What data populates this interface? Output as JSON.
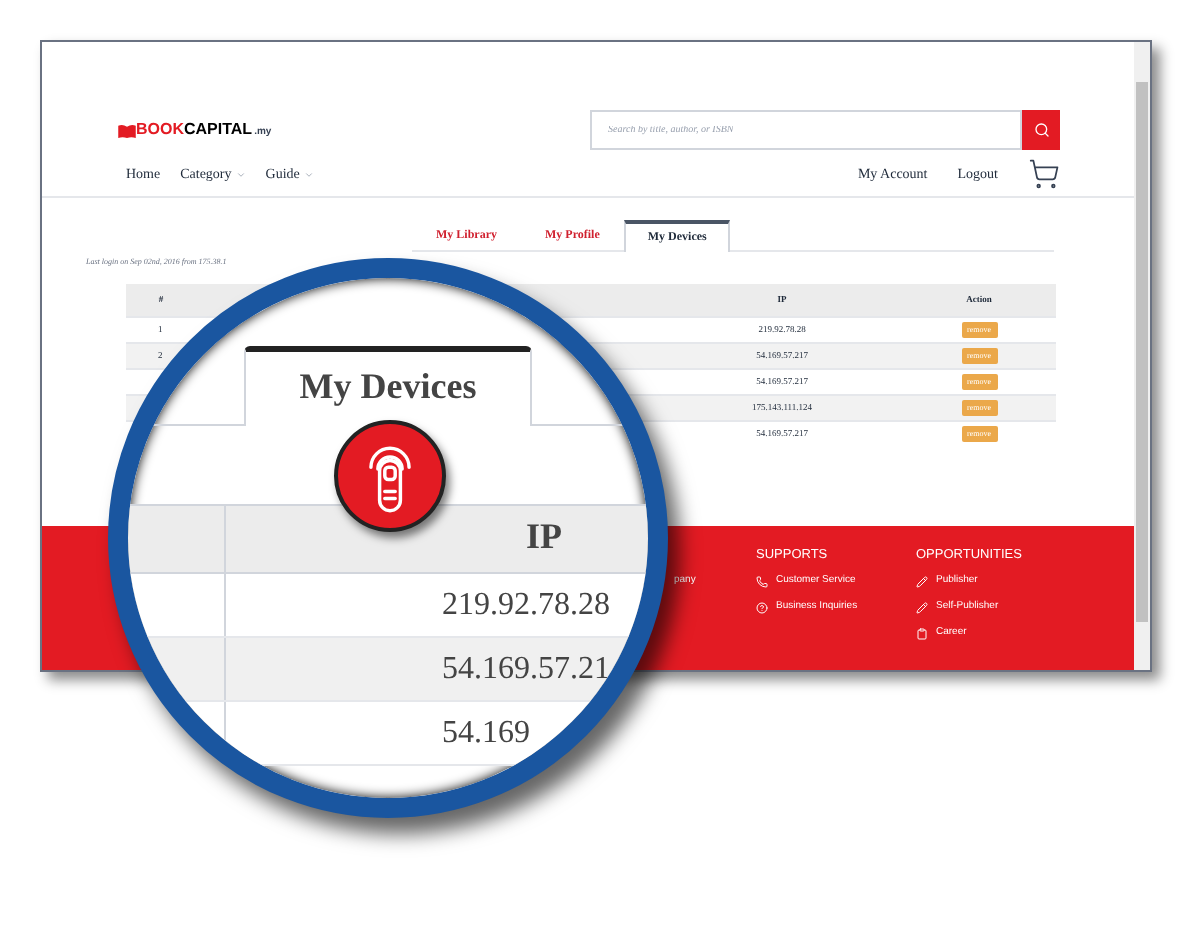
{
  "header": {
    "logo": {
      "part_1": "BOOK",
      "part_2": "CAPITAL",
      "suffix": ".my"
    },
    "search": {
      "placeholder": "Search by title, author, or ISBN"
    }
  },
  "nav": {
    "left": [
      {
        "label": "Home",
        "dropdown": false
      },
      {
        "label": "Category",
        "dropdown": true
      },
      {
        "label": "Guide",
        "dropdown": true
      }
    ],
    "right": [
      "My Account",
      "Logout"
    ]
  },
  "tabs": [
    {
      "label": "My Library",
      "selected": false
    },
    {
      "label": "My Profile",
      "selected": false
    },
    {
      "label": "My Devices",
      "selected": true
    }
  ],
  "last_login": "Last login on Sep 02nd, 2016 from 175.38.1",
  "table": {
    "columns": {
      "column_1": "#",
      "ip": "IP",
      "action": "Action"
    },
    "rows": [
      {
        "number": "1",
        "ip": "219.92.78.28",
        "action": "remove"
      },
      {
        "number": "2",
        "ip": "54.169.57.217",
        "action": "remove"
      },
      {
        "ip": "54.169.57.217",
        "action": "remove"
      },
      {
        "ip": "175.143.111.124",
        "action": "remove"
      },
      {
        "ip": "54.169.57.217",
        "action": "remove"
      }
    ]
  },
  "footer": {
    "columns": [
      {
        "items": [
          {
            "kind": "text",
            "label": "pany"
          }
        ]
      },
      {
        "heading": "SUPPORTS",
        "items": [
          {
            "kind": "phone",
            "label": "Customer Service"
          },
          {
            "kind": "question",
            "label": "Business Inquiries"
          }
        ]
      },
      {
        "heading": "OPPORTUNITIES",
        "items": [
          {
            "kind": "pencil",
            "label": "Publisher"
          },
          {
            "kind": "pencil",
            "label": "Self-Publisher"
          },
          {
            "kind": "clipboard",
            "label": "Career"
          }
        ]
      }
    ]
  },
  "magnifier": {
    "tab": "My Devices",
    "column": "IP",
    "values": [
      "219.92.78.28",
      "54.169.57.21",
      "54.169"
    ]
  }
}
